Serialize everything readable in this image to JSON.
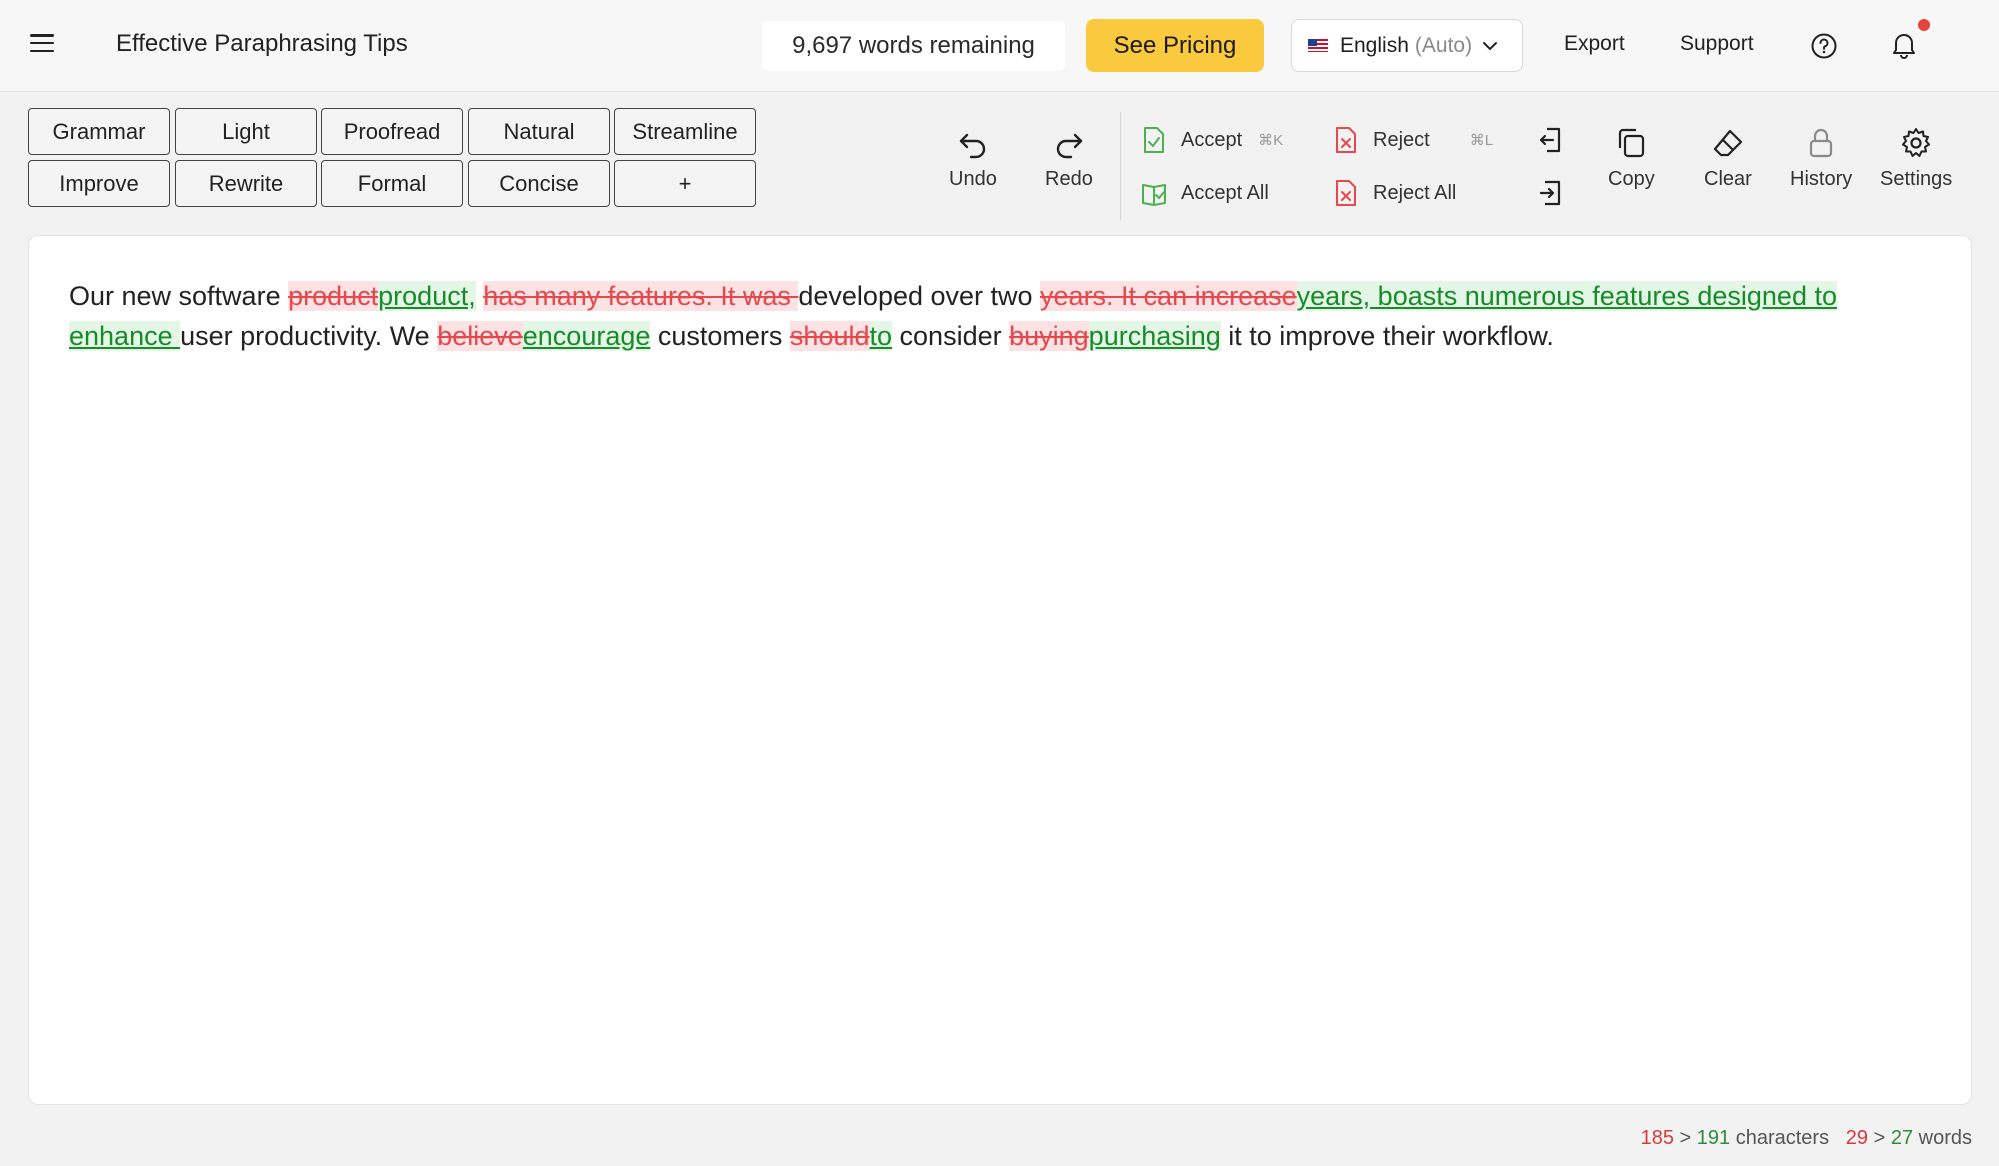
{
  "header": {
    "doc_title": "Effective Paraphrasing Tips",
    "words_remaining": "9,697 words remaining",
    "pricing_label": "See Pricing",
    "language": "English",
    "language_mode": "(Auto)",
    "export_label": "Export",
    "support_label": "Support"
  },
  "modes": {
    "row1": [
      "Grammar",
      "Light",
      "Proofread",
      "Natural",
      "Streamline"
    ],
    "row2": [
      "Improve",
      "Rewrite",
      "Formal",
      "Concise",
      "+"
    ]
  },
  "toolbar": {
    "undo": "Undo",
    "redo": "Redo",
    "accept": "Accept",
    "accept_shortcut": "⌘K",
    "accept_all": "Accept All",
    "reject": "Reject",
    "reject_shortcut": "⌘L",
    "reject_all": "Reject All",
    "copy": "Copy",
    "clear": "Clear",
    "history": "History",
    "settings": "Settings"
  },
  "editor": {
    "segments": [
      {
        "type": "plain",
        "text": "Our new software "
      },
      {
        "type": "del",
        "text": "product"
      },
      {
        "type": "ins",
        "text": "product,"
      },
      {
        "type": "plain",
        "text": " "
      },
      {
        "type": "del",
        "text": "has many features. It was "
      },
      {
        "type": "plain",
        "text": "developed over two "
      },
      {
        "type": "del",
        "text": "years. It can increase"
      },
      {
        "type": "ins",
        "text": "years, boasts numerous features designed to enhance "
      },
      {
        "type": "plain",
        "text": "user productivity. We "
      },
      {
        "type": "del",
        "text": "believe"
      },
      {
        "type": "ins",
        "text": "encourage"
      },
      {
        "type": "plain",
        "text": " customers "
      },
      {
        "type": "del",
        "text": "should"
      },
      {
        "type": "ins",
        "text": "to"
      },
      {
        "type": "plain",
        "text": " consider "
      },
      {
        "type": "del",
        "text": "buying"
      },
      {
        "type": "ins",
        "text": "purchasing"
      },
      {
        "type": "plain",
        "text": " it to improve their workflow."
      }
    ]
  },
  "stats": {
    "chars_before": "185",
    "chars_after": "191",
    "chars_label": "characters",
    "words_before": "29",
    "words_after": "27",
    "words_label": "words",
    "arrow": ">"
  },
  "colors": {
    "accent_yellow": "#fbc93d",
    "delete_red": "#e5484d",
    "insert_green": "#178a2a",
    "notification": "#e5423a"
  },
  "icons": {
    "menu": "menu-icon",
    "help": "help-circle-icon",
    "bell": "bell-icon",
    "undo": "undo-icon",
    "redo": "redo-icon",
    "accept": "check-document-icon",
    "accept_all": "open-book-check-icon",
    "reject": "x-document-icon",
    "reject_all": "x-document-icon",
    "import": "import-icon",
    "export": "export-icon",
    "copy": "copy-icon",
    "clear": "eraser-icon",
    "history": "lock-icon",
    "settings": "gear-icon"
  }
}
